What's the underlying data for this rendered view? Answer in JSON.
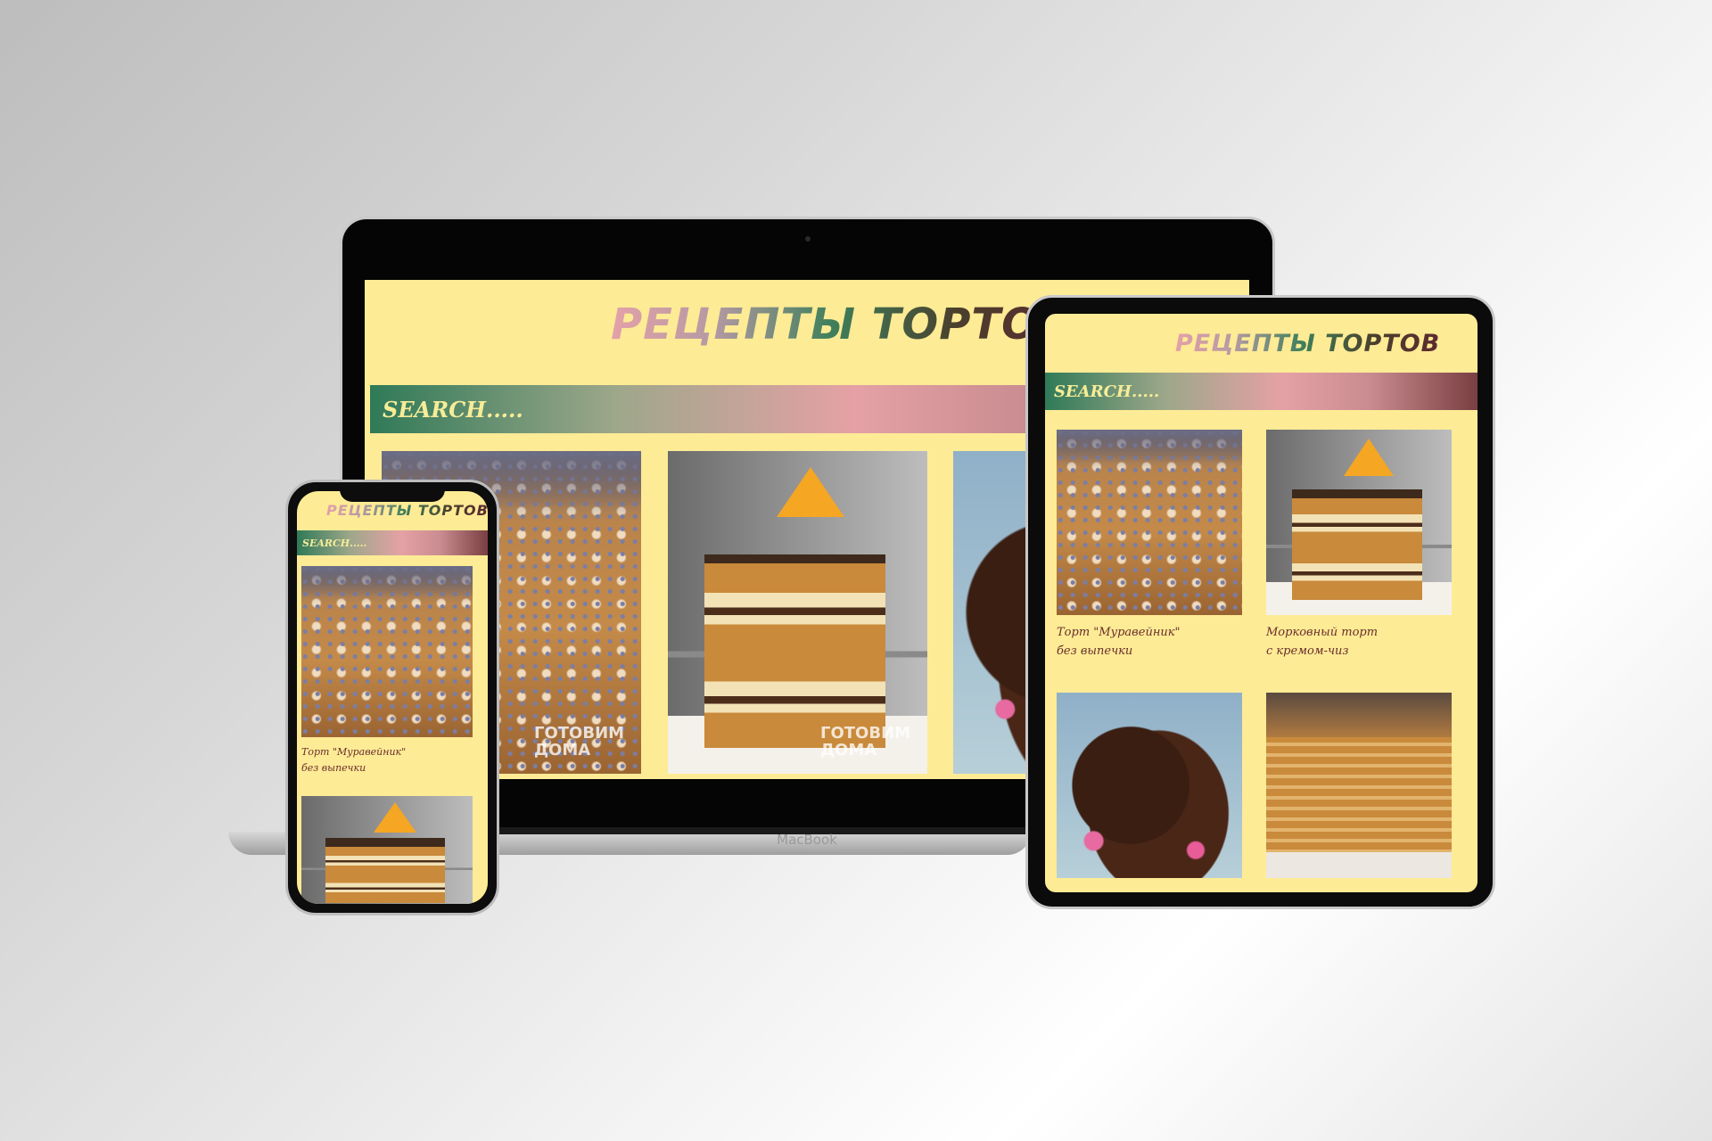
{
  "laptop": {
    "brand_label": "MacBook",
    "site_title": "РЕЦЕПТЫ ТОРТОВ",
    "search_placeholder": "SEARCH.....",
    "watermark": "ГОТОВИМ ДОМА"
  },
  "tablet": {
    "site_title": "РЕЦЕПТЫ ТОРТОВ",
    "search_placeholder": "SEARCH.....",
    "cards": [
      {
        "caption_line1": "Торт \"Муравейник\"",
        "caption_line2": "без выпечки"
      },
      {
        "caption_line1": "Морковный торт",
        "caption_line2": "с кремом-чиз"
      }
    ]
  },
  "phone": {
    "site_title": "РЕЦЕПТЫ ТОРТОВ",
    "search_placeholder": "SEARCH.....",
    "card": {
      "caption_line1": "Торт \"Муравейник\"",
      "caption_line2": "без выпечки"
    }
  },
  "colors": {
    "page_background": "#fdeb95",
    "search_text": "#f7ec98",
    "caption_text": "#6a2e2c"
  }
}
